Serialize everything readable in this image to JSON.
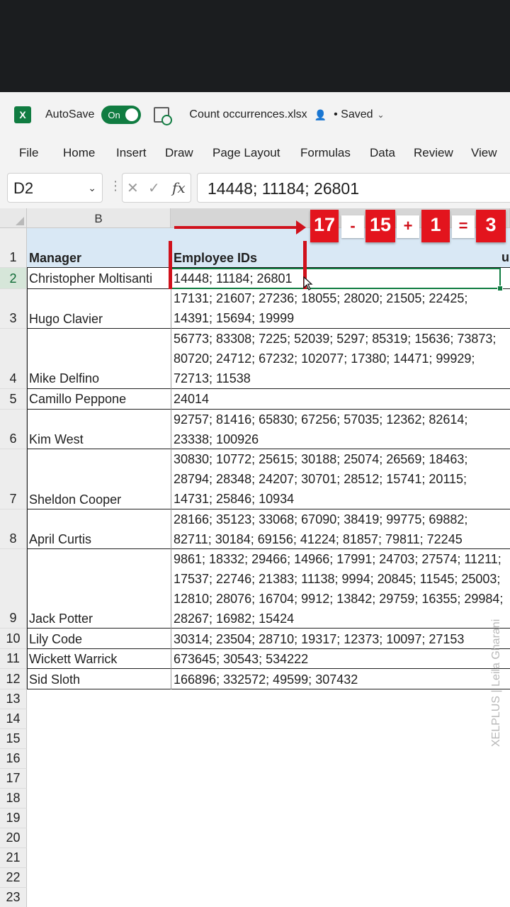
{
  "app": {
    "autosave_label": "AutoSave",
    "autosave_state": "On",
    "filename": "Count occurrences.xlsx",
    "saved_status": "• Saved"
  },
  "menu": [
    "File",
    "Home",
    "Insert",
    "Draw",
    "Page Layout",
    "Formulas",
    "Data",
    "Review",
    "View"
  ],
  "formula_bar": {
    "name_box": "D2",
    "formula": "14448; 11184; 26801"
  },
  "columns": [
    "B",
    ""
  ],
  "rows": [
    {
      "num": "1",
      "b": "Manager",
      "c": "Employee IDs"
    },
    {
      "num": "2",
      "b": "Christopher Moltisanti",
      "c": "14448; 11184; 26801"
    },
    {
      "num": "3",
      "b": "Hugo Clavier",
      "c": "17131; 21607; 27236; 18055; 28020; 21505; 22425; 14391; 15694; 19999"
    },
    {
      "num": "4",
      "b": "Mike Delfino",
      "c": "56773; 83308; 7225; 52039; 5297; 85319; 15636; 73873; 80720; 24712; 67232; 102077; 17380; 14471; 99929; 72713; 11538"
    },
    {
      "num": "5",
      "b": "Camillo Peppone",
      "c": "24014"
    },
    {
      "num": "6",
      "b": "Kim West",
      "c": "92757; 81416; 65830; 67256; 57035; 12362; 82614; 23338; 100926"
    },
    {
      "num": "7",
      "b": "Sheldon Cooper",
      "c": "30830; 10772; 25615; 30188; 25074; 26569; 18463; 28794; 28348; 24207; 30701; 28512; 15741; 20115; 14731; 25846; 10934"
    },
    {
      "num": "8",
      "b": "April Curtis",
      "c": "28166; 35123; 33068; 67090; 38419; 99775; 69882; 82711; 30184; 69156; 41224; 81857; 79811; 72245"
    },
    {
      "num": "9",
      "b": "Jack Potter",
      "c": "9861; 18332; 29466; 14966; 17991; 24703; 27574; 11211; 17537; 22746; 21383; 11138; 9994; 20845; 11545; 25003; 12810; 28076; 16704; 9912; 13842; 29759; 16355; 29984; 28267; 16982; 15424"
    },
    {
      "num": "10",
      "b": "Lily Code",
      "c": "30314; 23504; 28710; 19317; 12373; 10097; 27153"
    },
    {
      "num": "11",
      "b": "Wickett Warrick",
      "c": "673645; 30543; 534222"
    },
    {
      "num": "12",
      "b": "Sid Sloth",
      "c": "166896; 332572; 49599; 307432"
    }
  ],
  "empty_rows": [
    "13",
    "14",
    "15",
    "16",
    "17",
    "18",
    "19",
    "20",
    "21",
    "22",
    "23"
  ],
  "partial_header_char": "u",
  "equation": {
    "a": "17",
    "op1": "-",
    "b": "15",
    "op2": "+",
    "c": "1",
    "eq": "=",
    "result": "3"
  },
  "watermark": "XELPLUS | Leila Gharani",
  "colors": {
    "excel_green": "#107c41",
    "annotation_red": "#e3141d",
    "header_fill": "#d9e8f5"
  }
}
